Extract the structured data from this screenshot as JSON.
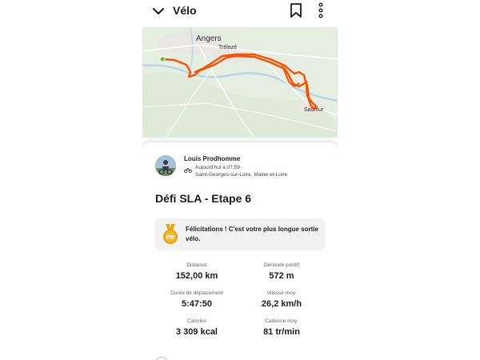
{
  "header": {
    "title": "Vélo",
    "back_icon": "chevron-down-icon",
    "bookmark_icon": "bookmark-icon",
    "more_icon": "more-vertical-icon"
  },
  "map": {
    "labels": {
      "angers": "Angers",
      "trelaze": "Trélazé",
      "saumur": "Saumur"
    },
    "route_color": "#fc5200",
    "start_color": "#52c41a"
  },
  "activity": {
    "athlete_name": "Louis Prodhomme",
    "meta_time": "Aujourd'hui à 07:59 ·",
    "meta_location": "Saint-Georges-sur-Loire, Maine-et-Loire",
    "sport_icon": "bike-icon",
    "title": "Défi SLA - Etape 6"
  },
  "achievement": {
    "icon": "pr-medal-icon",
    "badge_text": "PR",
    "message": "Félicitations ! C'est votre plus longue sortie vélo."
  },
  "stats": [
    {
      "label": "Distance",
      "value": "152,00 km"
    },
    {
      "label": "Dénivelé positif",
      "value": "572 m"
    },
    {
      "label": "Durée de déplacement",
      "value": "5:47:50"
    },
    {
      "label": "Vitesse moy.",
      "value": "26,2 km/h"
    },
    {
      "label": "Calories",
      "value": "3 309 kcal"
    },
    {
      "label": "Cadence moy.",
      "value": "81 tr/min"
    }
  ],
  "colors": {
    "accent": "#fc5200",
    "pr_gold": "#e8a317"
  }
}
